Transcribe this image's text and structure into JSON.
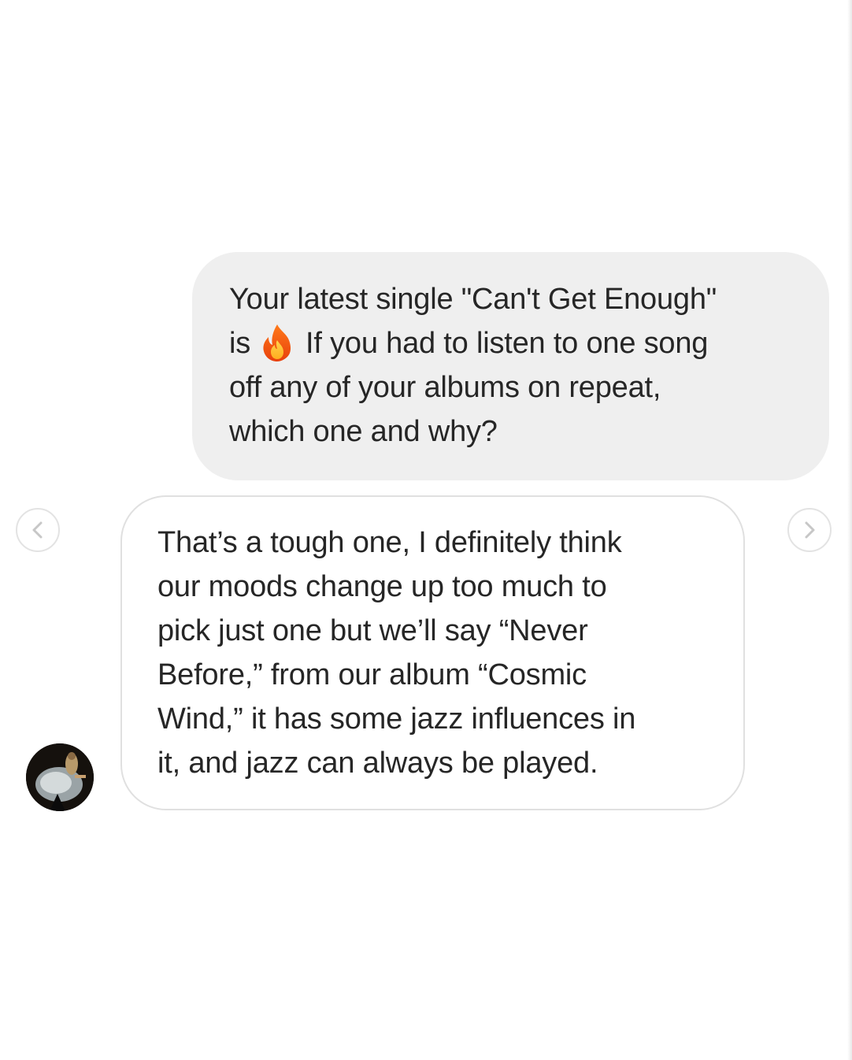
{
  "thread": {
    "outgoing_message": {
      "lines": [
        "Your latest single \"Can't Get Enough\"",
        "is",
        "If you had to listen to one song",
        "off any of your albums on repeat,",
        "which one and why?"
      ],
      "emoji": "fire-icon"
    },
    "incoming_message": {
      "lines": [
        "That’s a tough one, I definitely think",
        "our moods change up too much to",
        "pick just one but we’ll say “Never",
        "Before,” from our album “Cosmic",
        "Wind,” it has some jazz influences in",
        "it, and jazz can always be played."
      ]
    },
    "navigation": {
      "prev_icon": "chevron-left-icon",
      "next_icon": "chevron-right-icon"
    },
    "colors": {
      "outgoing_bubble": "#efefef",
      "incoming_border": "#e0e0e0",
      "text": "#262626"
    }
  }
}
